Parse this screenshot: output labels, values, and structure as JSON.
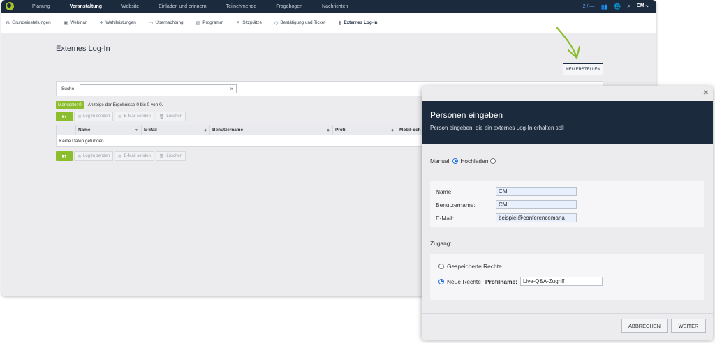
{
  "topnav": {
    "items": [
      "Planung",
      "Veranstaltung",
      "Website",
      "Einladen und erinnern",
      "Teilnehmende",
      "Fragebogen",
      "Nachrichten"
    ],
    "active_index": 1,
    "count": "2 / —",
    "user": "CM ⌵"
  },
  "subnav": {
    "items": [
      {
        "label": "Grundeinstellungen",
        "icon": "gear-icon"
      },
      {
        "label": "Webinar",
        "icon": "video-icon"
      },
      {
        "label": "Wahlleistungen",
        "icon": "options-icon"
      },
      {
        "label": "Übernachtung",
        "icon": "bed-icon"
      },
      {
        "label": "Programm",
        "icon": "calendar-icon"
      },
      {
        "label": "Sitzplätze",
        "icon": "seat-icon"
      },
      {
        "label": "Bestätigung und Ticket",
        "icon": "tag-icon"
      },
      {
        "label": "Externes Log-In",
        "icon": "key-icon"
      }
    ],
    "active_index": 7
  },
  "page": {
    "title": "Externes Log-In",
    "create_button": "NEU ERSTELLEN",
    "search_label": "Suche",
    "marker_label": "Markierte: 0",
    "result_info": "Anzeige der Ergebnisse 0 bis 0 von 0.",
    "actions": {
      "login": "Log-In senden",
      "email": "E-Mail senden",
      "delete": "Löschen"
    },
    "table": {
      "columns": [
        "Name",
        "E-Mail",
        "Benutzername",
        "Profil",
        "Mobil-Sch"
      ],
      "empty_text": "Keine Daten gefunden"
    }
  },
  "modal": {
    "title": "Personen eingeben",
    "subtitle": "Person eingeben, die ein externes Log-In erhalten soll",
    "mode_manual": "Manuell",
    "mode_upload": "Hochladen",
    "fields": {
      "name_label": "Name:",
      "name_value": "CM",
      "username_label": "Benutzername:",
      "username_value": "CM",
      "email_label": "E-Mail:",
      "email_value": "beispiel@conferencemana"
    },
    "access_label": "Zugang:",
    "saved_rights": "Gespeicherte Rechte",
    "new_rights": "Neue Rechte",
    "profile_label": "Profilname:",
    "profile_value": "Live-Q&A-Zugriff",
    "cancel_button": "ABBRECHEN",
    "next_button": "WEITER"
  },
  "colors": {
    "nav_dark": "#1b2a3d",
    "accent_green": "#8bbd2d",
    "radio_blue": "#1f6fe0"
  }
}
